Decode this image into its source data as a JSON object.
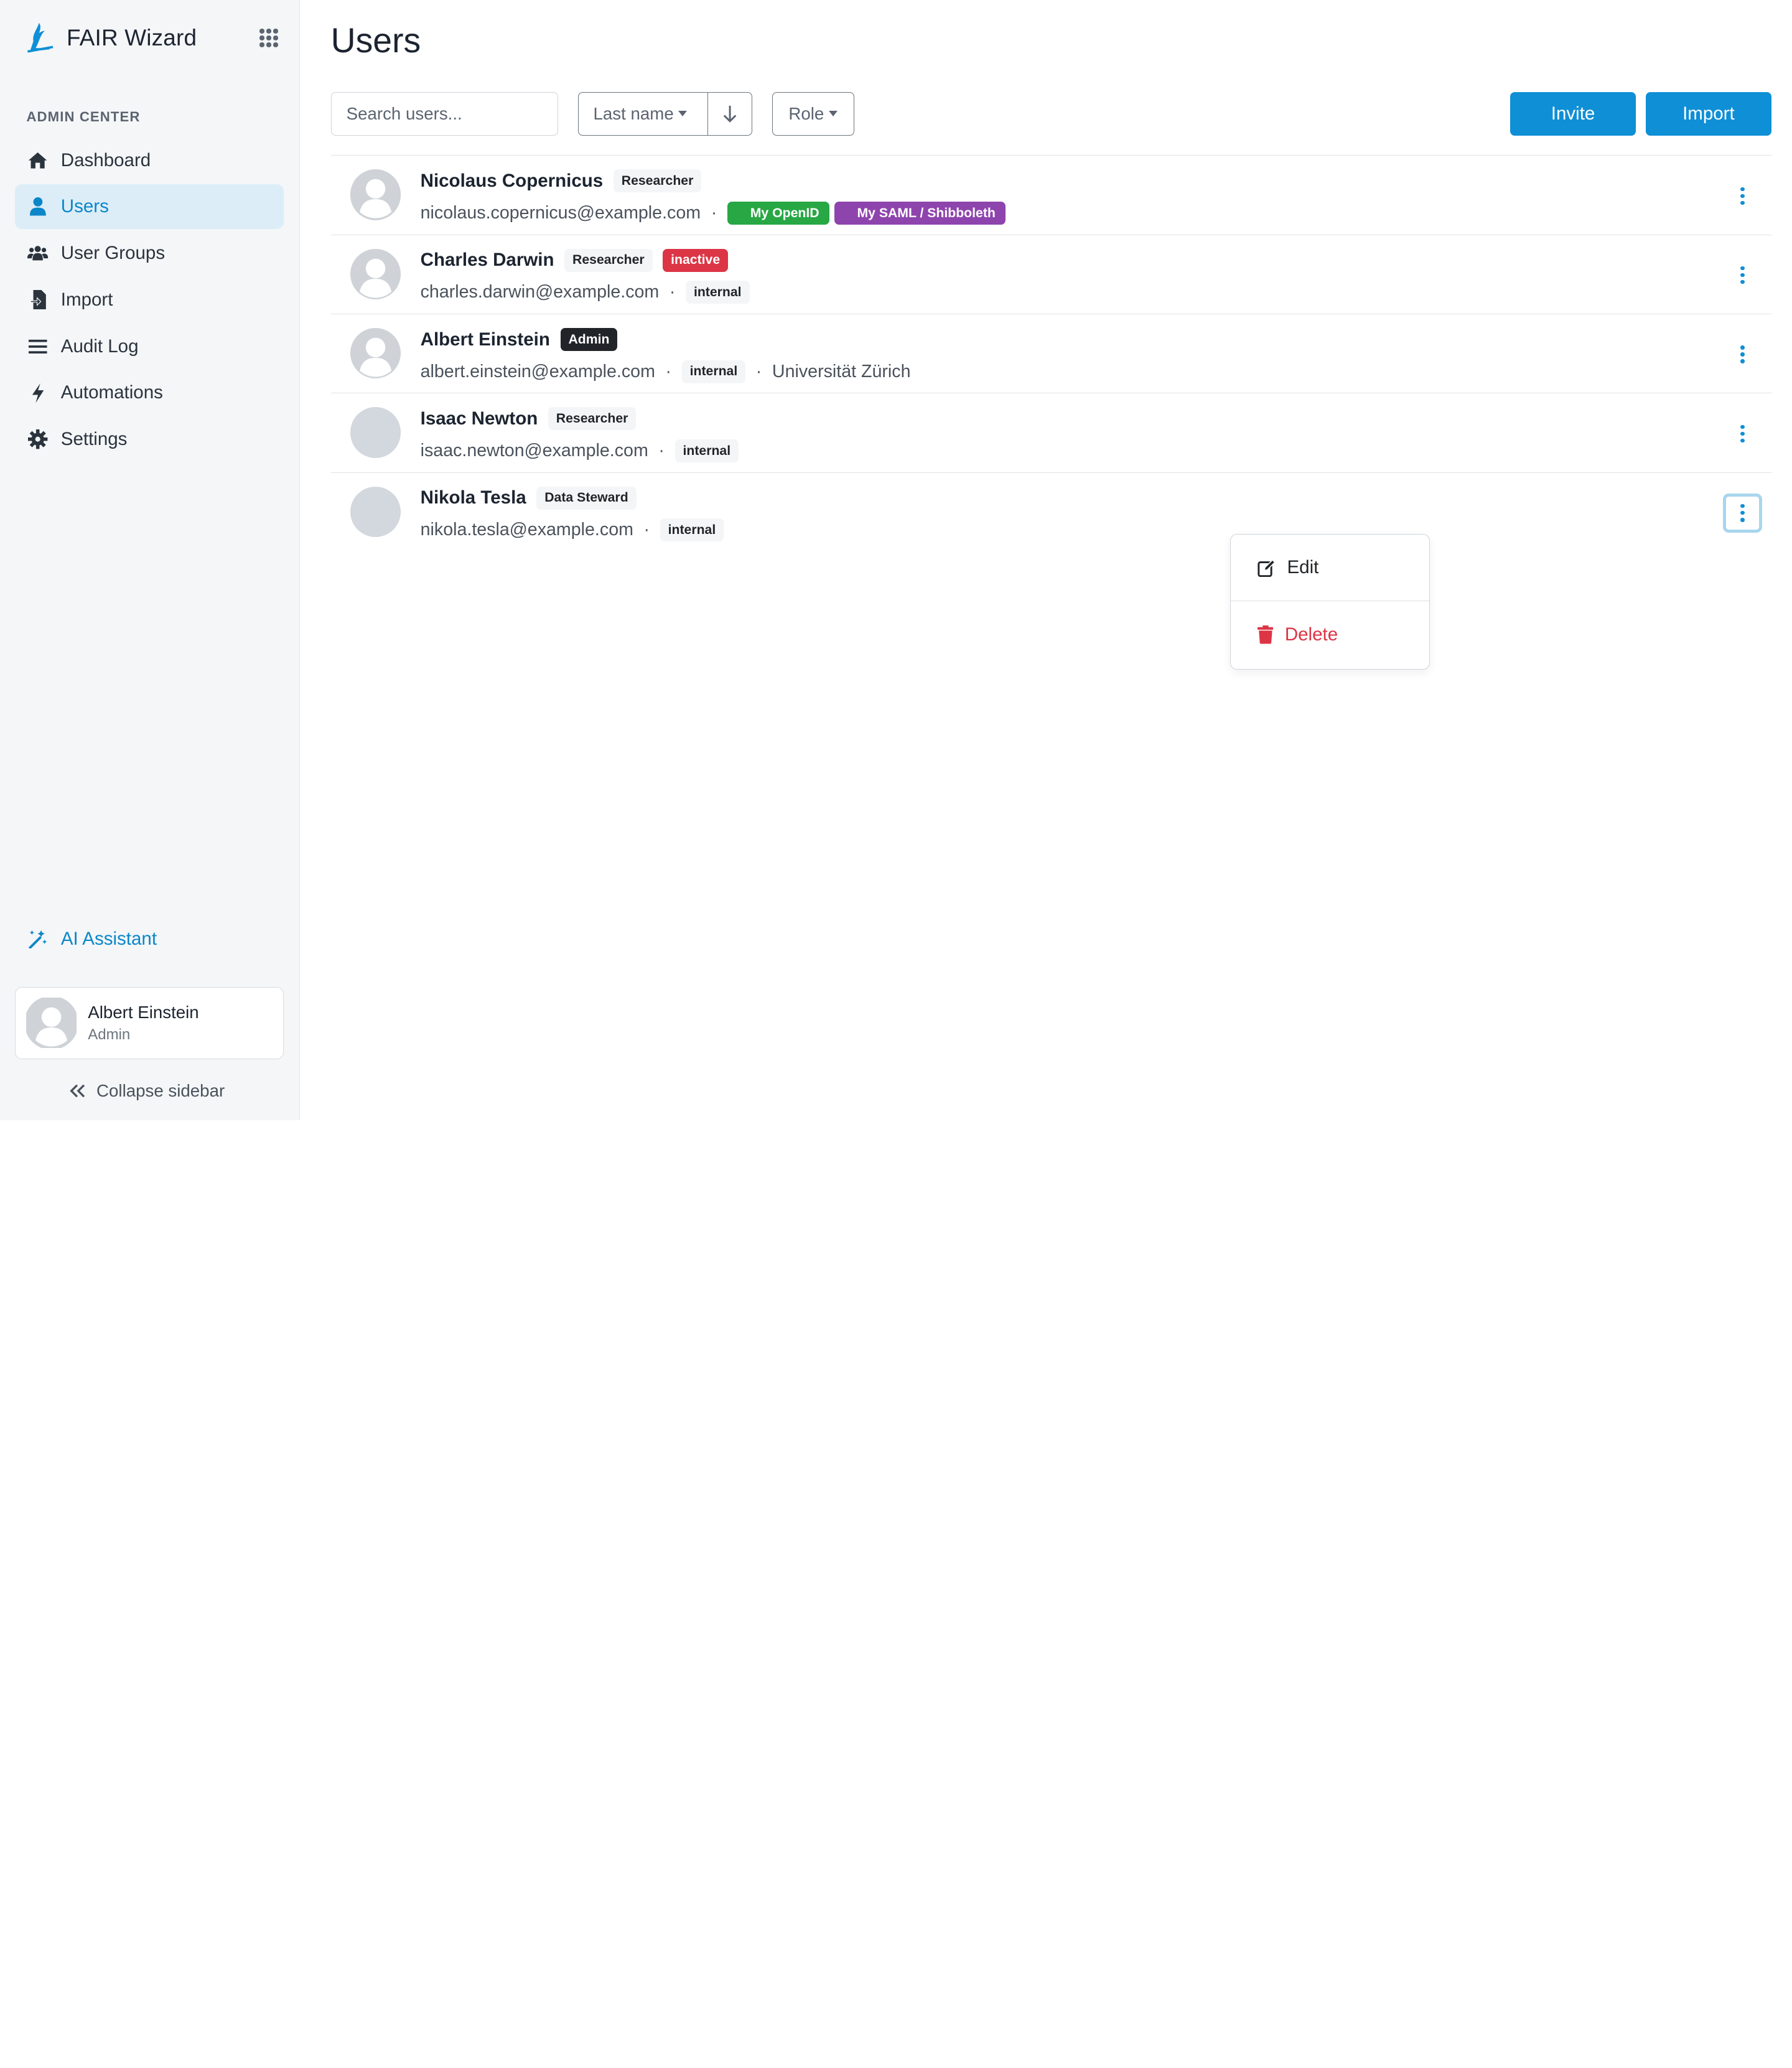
{
  "brand": {
    "name": "FAIR Wizard"
  },
  "sidebar": {
    "section_label": "ADMIN CENTER",
    "items": [
      {
        "label": "Dashboard",
        "icon": "home-icon"
      },
      {
        "label": "Users",
        "icon": "user-icon",
        "active": true
      },
      {
        "label": "User Groups",
        "icon": "users-icon"
      },
      {
        "label": "Import",
        "icon": "import-icon"
      },
      {
        "label": "Audit Log",
        "icon": "list-icon"
      },
      {
        "label": "Automations",
        "icon": "bolt-icon"
      },
      {
        "label": "Settings",
        "icon": "gear-icon"
      }
    ],
    "ai_assistant": "AI Assistant",
    "current_user": {
      "name": "Albert Einstein",
      "role": "Admin"
    },
    "collapse_label": "Collapse sidebar"
  },
  "main": {
    "title": "Users",
    "search_placeholder": "Search users...",
    "sort_field": "Last name",
    "role_filter": "Role",
    "invite_label": "Invite",
    "import_label": "Import"
  },
  "users": [
    {
      "name": "Nicolaus Copernicus",
      "role": "Researcher",
      "email": "nicolaus.copernicus@example.com",
      "auth": [
        "My OpenID",
        "My SAML / Shibboleth"
      ],
      "affiliation": ""
    },
    {
      "name": "Charles Darwin",
      "role": "Researcher",
      "status": "inactive",
      "email": "charles.darwin@example.com",
      "source": "internal",
      "affiliation": ""
    },
    {
      "name": "Albert Einstein",
      "role": "Admin",
      "email": "albert.einstein@example.com",
      "source": "internal",
      "affiliation": "Universität Zürich"
    },
    {
      "name": "Isaac Newton",
      "role": "Researcher",
      "email": "isaac.newton@example.com",
      "source": "internal",
      "affiliation": ""
    },
    {
      "name": "Nikola Tesla",
      "role": "Data Steward",
      "email": "nikola.tesla@example.com",
      "source": "internal",
      "affiliation": ""
    }
  ],
  "dropdown": {
    "edit_label": "Edit",
    "delete_label": "Delete"
  },
  "colors": {
    "accent": "#0f8fd6",
    "danger": "#dc3545",
    "openid": "#28a745",
    "saml": "#8e44ad"
  }
}
